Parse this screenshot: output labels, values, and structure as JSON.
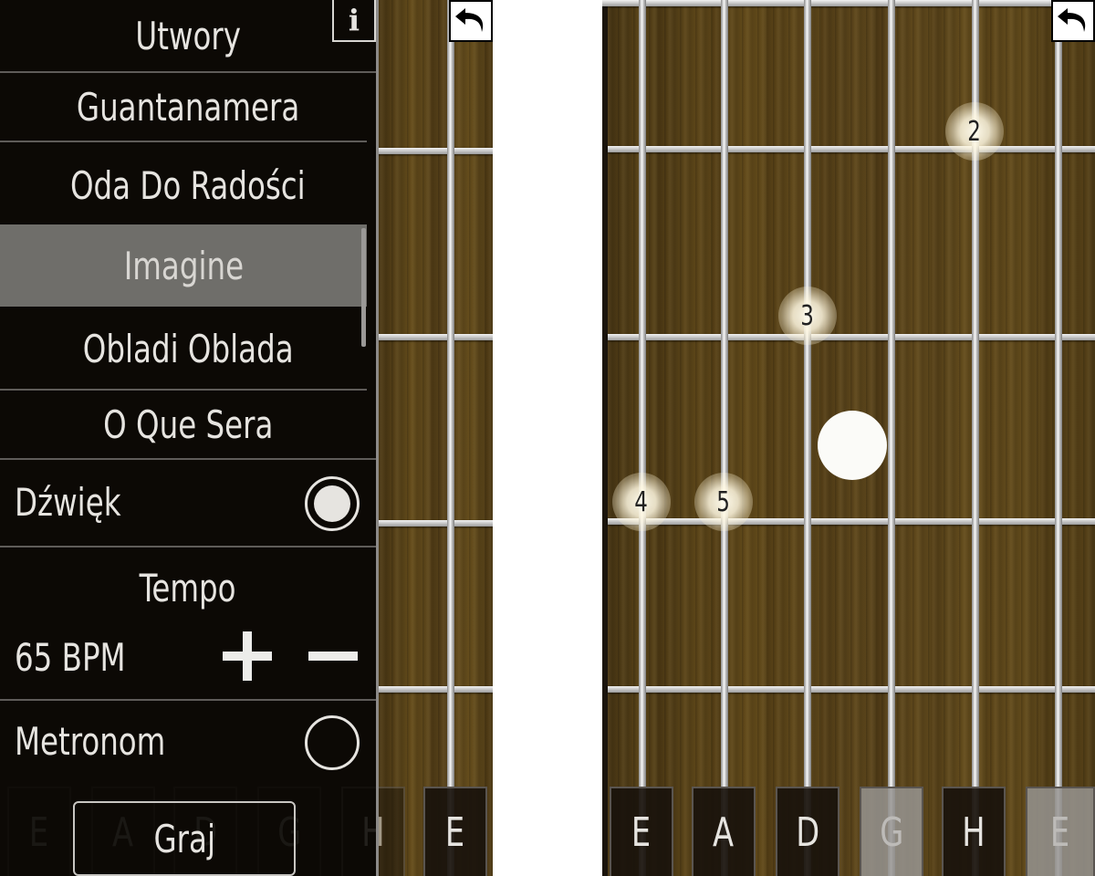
{
  "left_screen": {
    "info_label": "i",
    "back_icon": "undo-arrow-icon",
    "songs": {
      "header": "Utwory",
      "items": [
        "Guantanamera",
        "Oda Do Radości",
        "Imagine",
        "Obladi Oblada",
        "O Que Sera"
      ],
      "selected": "Imagine"
    },
    "sound": {
      "label": "Dźwięk",
      "enabled": true
    },
    "tempo": {
      "label": "Tempo",
      "value": "65 BPM",
      "plus_icon": "plus-icon",
      "minus_icon": "minus-icon"
    },
    "metronome": {
      "label": "Metronom",
      "enabled": false
    },
    "play_button": "Graj",
    "string_keys": [
      "E",
      "A",
      "D",
      "G",
      "H",
      "E"
    ]
  },
  "right_screen": {
    "back_icon": "undo-arrow-icon",
    "finger_markers": [
      "2",
      "3",
      "4",
      "5"
    ],
    "string_keys": [
      {
        "label": "E",
        "active": false
      },
      {
        "label": "A",
        "active": false
      },
      {
        "label": "D",
        "active": false
      },
      {
        "label": "G",
        "active": true
      },
      {
        "label": "H",
        "active": false
      },
      {
        "label": "E",
        "active": true
      }
    ]
  },
  "colors": {
    "wood": "#5a4419",
    "panel": "#0a0704",
    "selected_row": "#8c8a87",
    "text": "#e6e4e0"
  }
}
